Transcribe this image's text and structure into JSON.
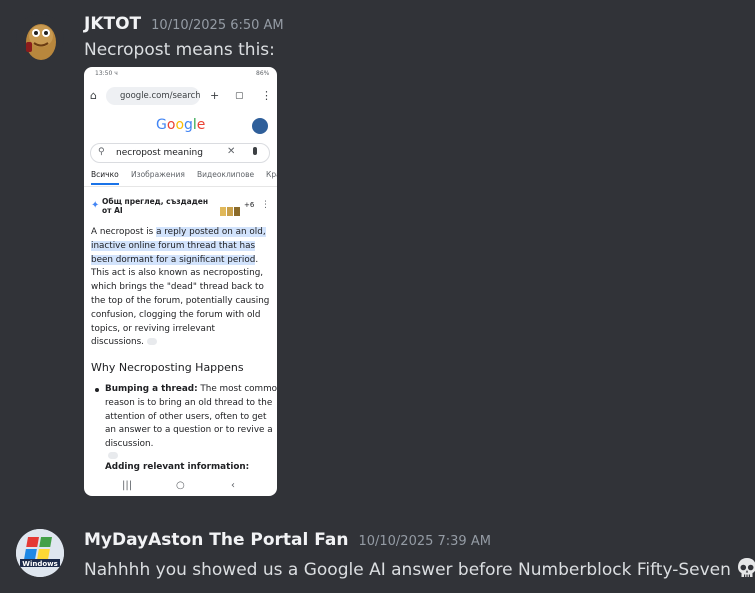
{
  "messages": [
    {
      "username": "JKTOT",
      "timestamp": "10/10/2025 6:50 AM",
      "content": "Necropost means this:"
    },
    {
      "username": "MyDayAston The Portal Fan",
      "timestamp": "10/10/2025 7:39 AM",
      "content": "Nahhhh you showed us a Google AI answer before Numberblock Fifty-Seven",
      "emoji": "skull-emoji"
    }
  ],
  "attachment": {
    "status_time": "13:50 ч",
    "status_battery": "86%",
    "url": "google.com/search",
    "logo": "Google",
    "query": "necropost meaning",
    "tabs": [
      "Всичко",
      "Изображения",
      "Видеоклипове",
      "Кра"
    ],
    "ai_overview_title_line1": "Общ преглед, създаден",
    "ai_overview_title_line2": "от AI",
    "ai_badge_count": "+6",
    "paragraph_lines": [
      {
        "pre": "A necropost is ",
        "hl": "a reply posted on an old,",
        "post": ""
      },
      {
        "pre": "",
        "hl": "inactive online forum thread that has",
        "post": ""
      },
      {
        "pre": "",
        "hl": "been dormant for a significant period",
        "post": "."
      },
      {
        "pre": "This act is also known as necroposting,",
        "hl": "",
        "post": ""
      },
      {
        "pre": "which brings the \"dead\" thread back to",
        "hl": "",
        "post": ""
      },
      {
        "pre": "the top of the forum, potentially causing",
        "hl": "",
        "post": ""
      },
      {
        "pre": "confusion, clogging the forum with old",
        "hl": "",
        "post": ""
      },
      {
        "pre": "topics, or reviving irrelevant",
        "hl": "",
        "post": ""
      },
      {
        "pre": "discussions.",
        "hl": "",
        "post": ""
      }
    ],
    "heading": "Why Necroposting Happens",
    "bullet1_label": "Bumping a thread:",
    "bullet1_lines": [
      " The most common",
      "reason is to bring an old thread to the",
      "attention of other users, often to get",
      "an answer to a question or to revive a",
      "discussion."
    ],
    "bullet2_label": "Adding relevant information:"
  }
}
